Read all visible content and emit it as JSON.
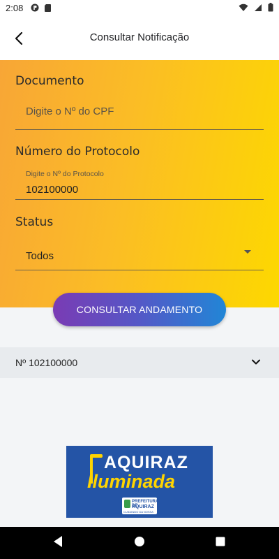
{
  "status_bar": {
    "time": "2:08"
  },
  "app_bar": {
    "title": "Consultar Notificação"
  },
  "form": {
    "document": {
      "label": "Documento",
      "placeholder": "Digite o Nº do CPF"
    },
    "protocol": {
      "label": "Número do Protocolo",
      "floating_label": "Digite o Nº do Protocolo",
      "value": "102100000"
    },
    "status": {
      "label": "Status",
      "selected": "Todos"
    },
    "submit_label": "CONSULTAR ANDAMENTO"
  },
  "result": {
    "title": "Nº 102100000"
  },
  "logo": {
    "line1": "AQUIRAZ",
    "line2": "Iluminada",
    "seal_top": "PREFEITURA DE",
    "seal_name": "AQUIRAZ",
    "seal_motto": "CUIDANDO DA NOSSA GENTE"
  },
  "colors": {
    "gradient_start": "#f8a636",
    "gradient_end": "#fdd800",
    "button_start": "#7a3bb4",
    "button_end": "#2186d6",
    "logo_bg": "#2454a6"
  }
}
